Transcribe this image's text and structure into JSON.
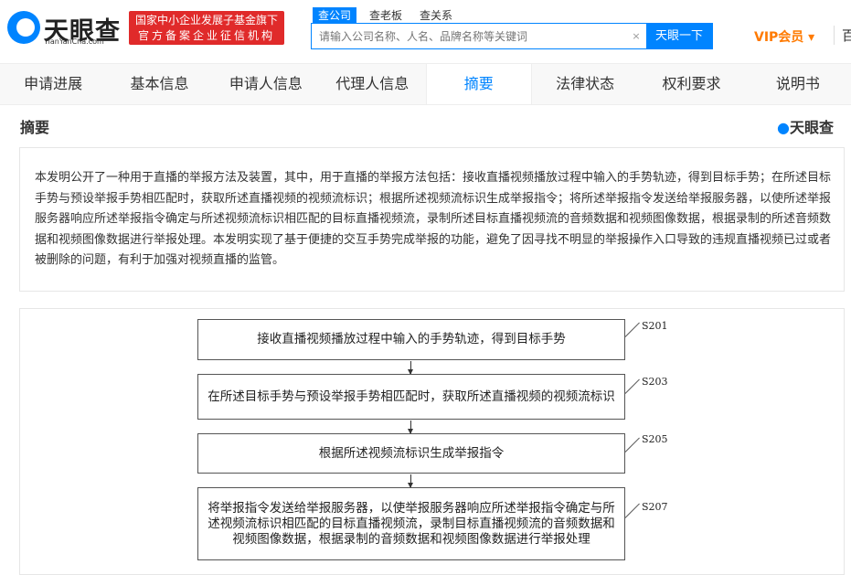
{
  "header": {
    "logo": "天眼查",
    "logo_sub": "TianYanCha.com",
    "badge_line1": "国家中小企业发展子基金旗下",
    "badge_line2": "官方备案企业征信机构",
    "search_tabs": [
      "查公司",
      "查老板",
      "查关系"
    ],
    "search_placeholder": "请输入公司名称、人名、品牌名称等关键词",
    "clear": "×",
    "search_button": "天眼一下",
    "vip": "VIP会员 ▾",
    "cut_text": "百"
  },
  "tabs": [
    "申请进展",
    "基本信息",
    "申请人信息",
    "代理人信息",
    "摘要",
    "法律状态",
    "权利要求",
    "说明书"
  ],
  "section": {
    "title": "摘要",
    "watermark": "天眼查"
  },
  "abstract": "本发明公开了一种用于直播的举报方法及装置，其中，用于直播的举报方法包括：接收直播视频播放过程中输入的手势轨迹，得到目标手势；在所述目标手势与预设举报手势相匹配时，获取所述直播视频的视频流标识；根据所述视频流标识生成举报指令；将所述举报指令发送给举报服务器，以使所述举报服务器响应所述举报指令确定与所述视频流标识相匹配的目标直播视频流，录制所述目标直播视频流的音频数据和视频图像数据，根据录制的所述音频数据和视频图像数据进行举报处理。本发明实现了基于便捷的交互手势完成举报的功能，避免了因寻找不明显的举报操作入口导致的违规直播视频已过或者被删除的问题，有利于加强对视频直播的监管。",
  "flowchart": [
    {
      "step": "S201",
      "text": "接收直播视频播放过程中输入的手势轨迹，得到目标手势"
    },
    {
      "step": "S203",
      "text": "在所述目标手势与预设举报手势相匹配时，获取所述直播视频的视频流标识"
    },
    {
      "step": "S205",
      "text": "根据所述视频流标识生成举报指令"
    },
    {
      "step": "S207",
      "text": "将举报指令发送给举报服务器，以使举报服务器响应所述举报指令确定与所述视频流标识相匹配的目标直播视频流，录制目标直播视频流的音频数据和视频图像数据，根据录制的音频数据和视频图像数据进行举报处理"
    }
  ]
}
